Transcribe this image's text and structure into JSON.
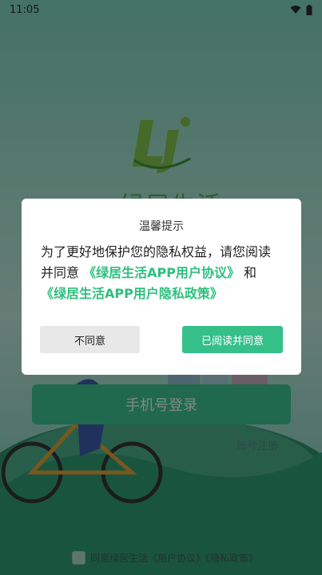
{
  "status_bar": {
    "time": "11:05",
    "icons": [
      "wifi-icon",
      "battery-icon"
    ]
  },
  "app": {
    "title": "绿居生活"
  },
  "login": {
    "phone_login_label": "手机号登录",
    "register_label": "账号注册",
    "agreement_text": "同意绿居生活《用户协议》《隐私政策》"
  },
  "dialog": {
    "title": "温馨提示",
    "body_prefix": "为了更好地保护您的隐私权益，请您阅读并同意",
    "user_agreement_link": "《绿居生活APP用户协议》",
    "connector": "和",
    "privacy_policy_link": "《绿居生活APP用户隐私政策》",
    "disagree_label": "不同意",
    "agree_label": "已阅读并同意"
  },
  "colors": {
    "accent": "#35c08a",
    "link": "#2fbf7f",
    "brand_green": "#4cae62"
  }
}
